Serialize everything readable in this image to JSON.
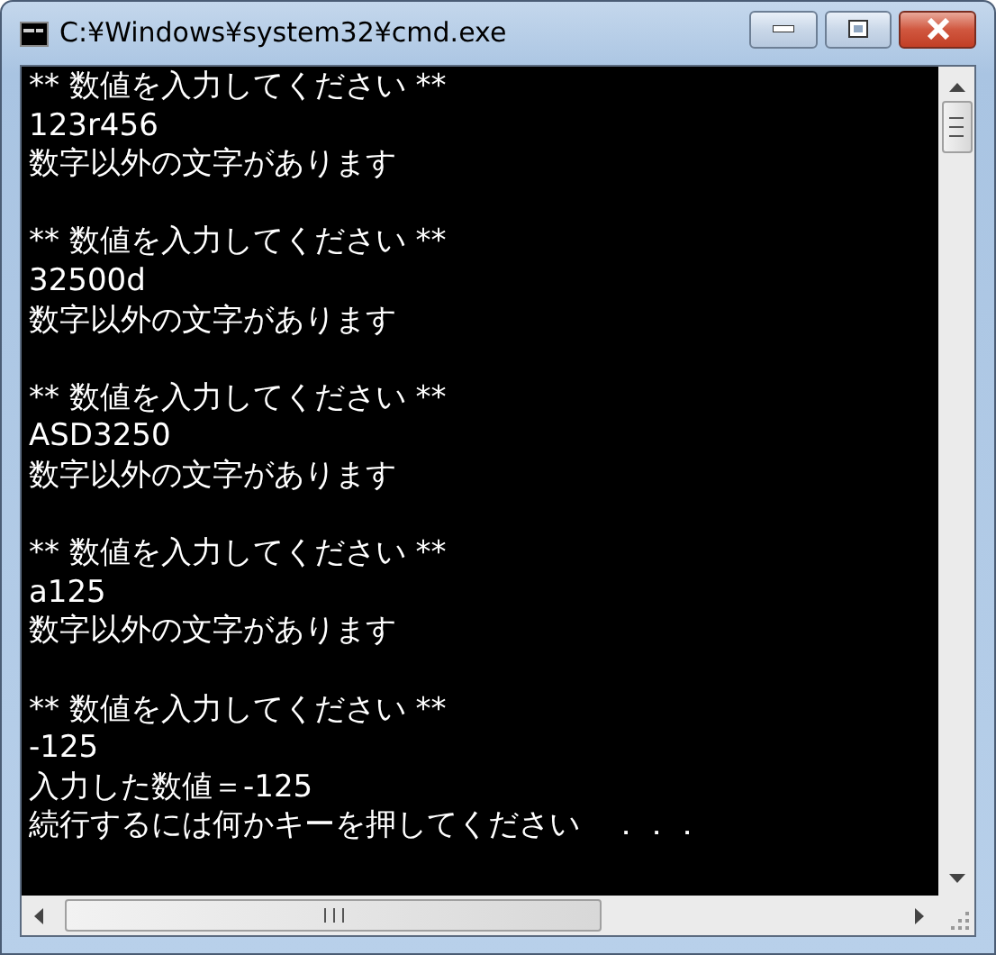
{
  "window": {
    "title": "C:¥Windows¥system32¥cmd.exe"
  },
  "console": {
    "blocks": [
      {
        "lines": [
          "** 数値を入力してください **",
          "123r456",
          "数字以外の文字があります"
        ]
      },
      {
        "lines": [
          "** 数値を入力してください **",
          "32500d",
          "数字以外の文字があります"
        ]
      },
      {
        "lines": [
          "** 数値を入力してください **",
          "ASD3250",
          "数字以外の文字があります"
        ]
      },
      {
        "lines": [
          "** 数値を入力してください **",
          "a125",
          "数字以外の文字があります"
        ]
      },
      {
        "lines": [
          "** 数値を入力してください **",
          "-125",
          "入力した数値＝-125",
          "続行するには何かキーを押してください　．．．"
        ]
      }
    ]
  }
}
